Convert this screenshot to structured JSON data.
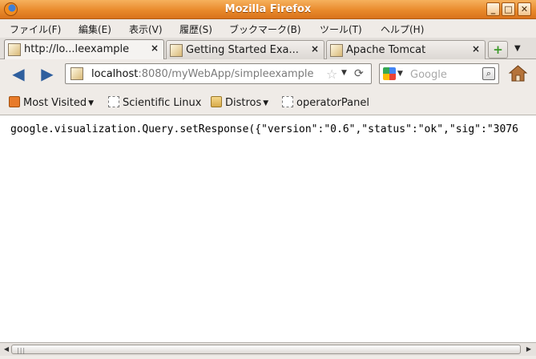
{
  "window": {
    "title": "Mozilla Firefox",
    "controls": {
      "minimize": "_",
      "maximize": "□",
      "close": "✕"
    }
  },
  "menu": {
    "items": [
      "ファイル(F)",
      "編集(E)",
      "表示(V)",
      "履歴(S)",
      "ブックマーク(B)",
      "ツール(T)",
      "ヘルプ(H)"
    ]
  },
  "tabs": [
    {
      "label": "http://lo...leexample",
      "active": true
    },
    {
      "label": "Getting Started Exa...",
      "active": false
    },
    {
      "label": "Apache Tomcat",
      "active": false
    }
  ],
  "tab_close_glyph": "×",
  "new_tab_glyph": "+",
  "tab_list_glyph": "▼",
  "nav": {
    "back_glyph": "◀",
    "forward_glyph": "▶",
    "url_host": "localhost",
    "url_rest": ":8080/myWebApp/simpleexample",
    "star_glyph": "☆",
    "dropdown_glyph": "▼",
    "reload_glyph": "⟳"
  },
  "search": {
    "engine": "google-icon",
    "placeholder": "Google",
    "button_glyph": "🔍"
  },
  "bookmarks": [
    {
      "label": "Most Visited",
      "icon": "feed-icon",
      "has_menu": true
    },
    {
      "label": "Scientific Linux",
      "icon": "page-icon",
      "has_menu": false
    },
    {
      "label": "Distros",
      "icon": "folder-icon",
      "has_menu": true
    },
    {
      "label": "operatorPanel",
      "icon": "page-icon",
      "has_menu": false
    }
  ],
  "content": {
    "text": "google.visualization.Query.setResponse({\"version\":\"0.6\",\"status\":\"ok\",\"sig\":\"3076"
  },
  "scrollbar": {
    "left_arrow": "◀",
    "right_arrow": "▶",
    "grip": "|||"
  },
  "colors": {
    "titlebar": "#e98a2c",
    "chrome_bg": "#efebe7",
    "url_rest": "#7b7b7b"
  }
}
